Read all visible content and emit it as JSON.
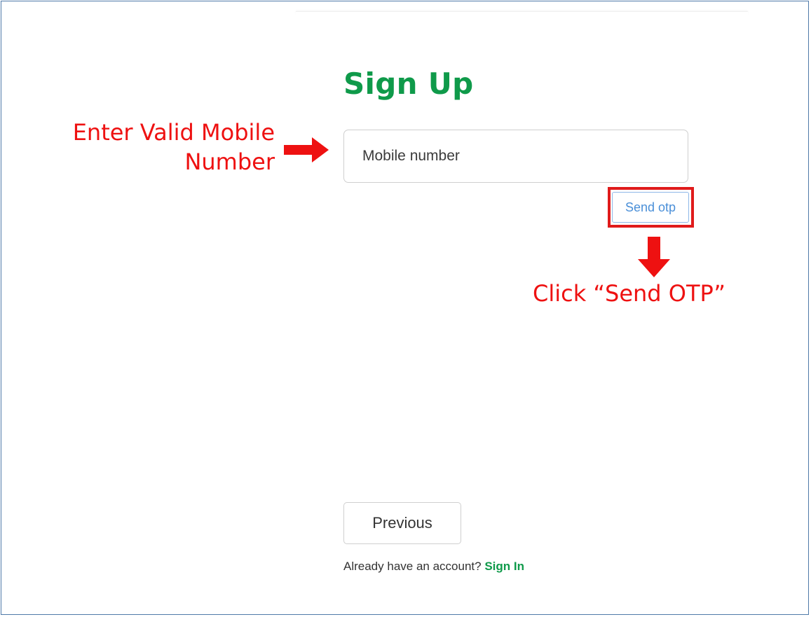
{
  "form": {
    "title": "Sign Up",
    "mobile_placeholder": "Mobile number",
    "mobile_value": "",
    "send_otp_label": "Send otp",
    "previous_label": "Previous",
    "account_prompt": "Already have an account?",
    "signin_label": "Sign In"
  },
  "annotations": {
    "enter_mobile_line1": "Enter Valid Mobile",
    "enter_mobile_line2": "Number",
    "click_send_otp": "Click “Send OTP”"
  },
  "icons": {
    "arrow_right": "arrow-right-icon",
    "arrow_down": "arrow-down-icon"
  },
  "colors": {
    "brand_green": "#0f9a4a",
    "annotation_red": "#ee1111",
    "link_blue": "#4a8fd8",
    "frame_border": "#4f7aa8"
  }
}
